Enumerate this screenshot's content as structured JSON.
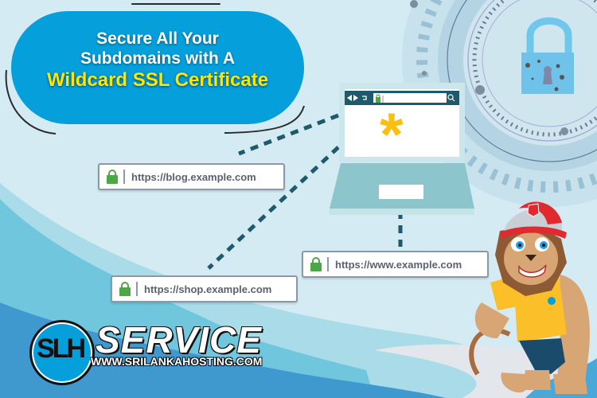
{
  "headline": {
    "line1": "Secure All Your",
    "line2": "Subdomains with A",
    "line3": "Wildcard SSL Certificate"
  },
  "url_bars": [
    {
      "name": "blog",
      "url": "https://blog.example.com",
      "icon": "lock-icon"
    },
    {
      "name": "www",
      "url": "https://www.example.com",
      "icon": "lock-icon"
    },
    {
      "name": "shop",
      "url": "https://shop.example.com",
      "icon": "lock-icon"
    }
  ],
  "laptop": {
    "screen_symbol": "*",
    "toolbar_icons": [
      "back-icon",
      "forward-icon",
      "refresh-icon",
      "lock-icon",
      "search-icon"
    ]
  },
  "branding": {
    "logo_text": "SLH",
    "title": "SERVICE",
    "website": "WWW.SRILANKAHOSTING.COM"
  },
  "colors": {
    "background": "#d4ebf4",
    "pill": "#05a0dc",
    "highlight": "#ffe600",
    "lock_green": "#4ea746",
    "dash": "#1e5a6c",
    "asterisk": "#fbbf10",
    "mascot_shirt": "#fbbf2a",
    "mascot_cap": "#e02a2f"
  }
}
